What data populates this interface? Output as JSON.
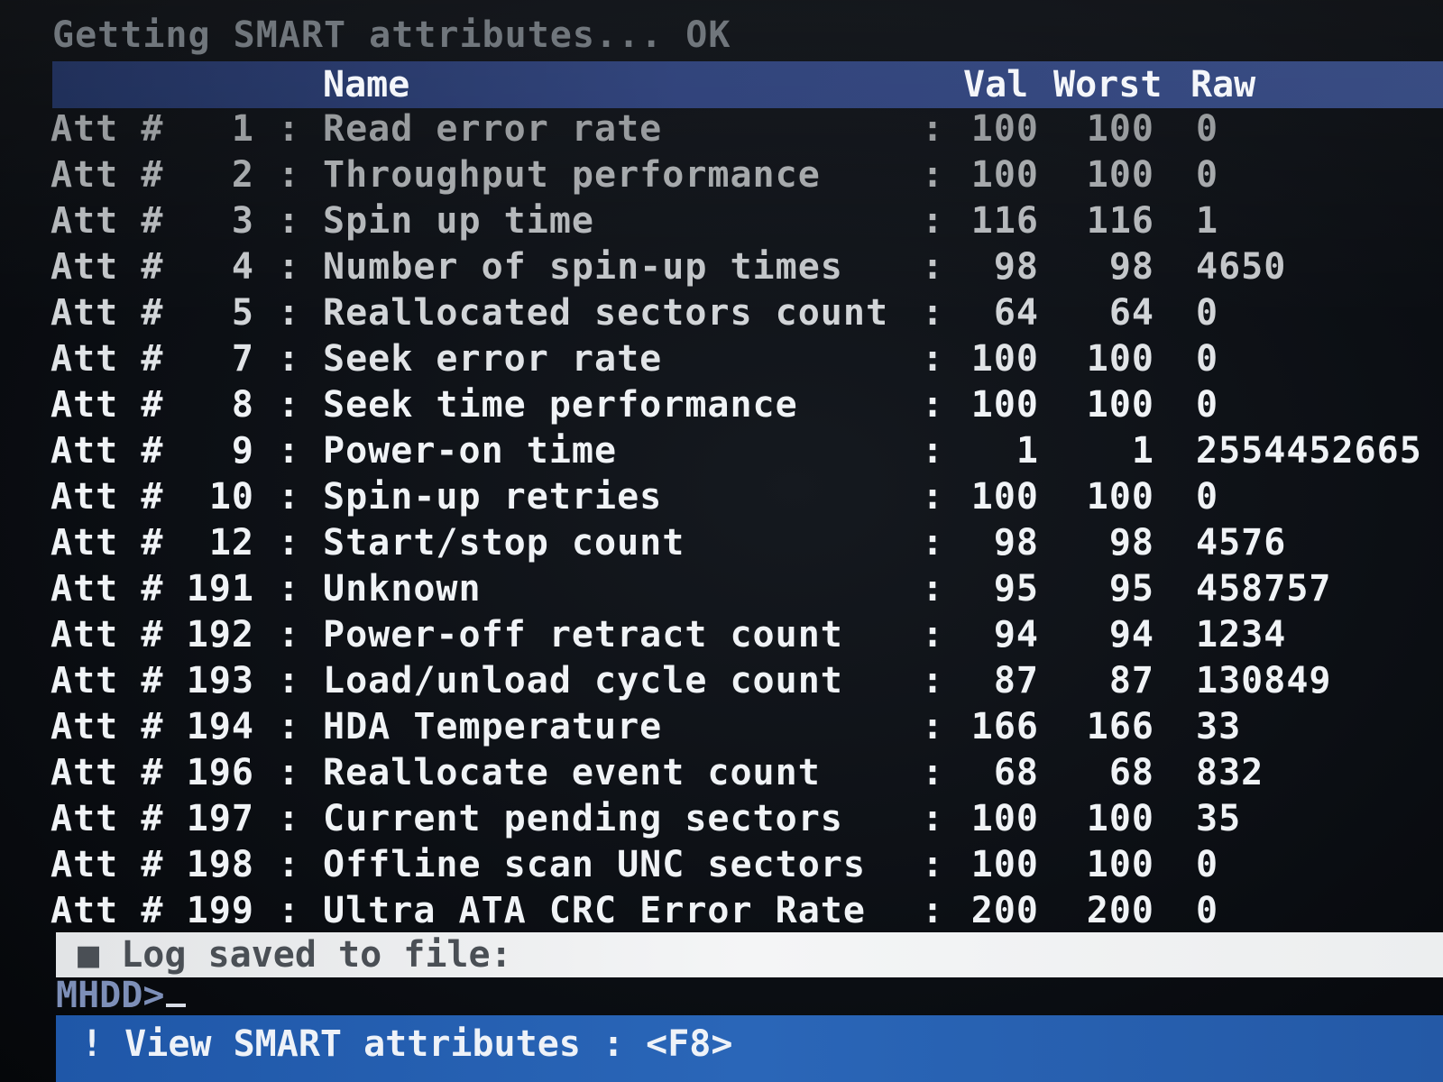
{
  "status": {
    "text": "Getting SMART attributes... OK"
  },
  "header": {
    "name": "Name",
    "val": "Val",
    "worst": "Worst",
    "raw": "Raw"
  },
  "rows": [
    {
      "prefix": "Att #",
      "num": "1",
      "name": "Read error rate",
      "val": "100",
      "worst": "100",
      "raw": "0"
    },
    {
      "prefix": "Att #",
      "num": "2",
      "name": "Throughput performance",
      "val": "100",
      "worst": "100",
      "raw": "0"
    },
    {
      "prefix": "Att #",
      "num": "3",
      "name": "Spin up time",
      "val": "116",
      "worst": "116",
      "raw": "1"
    },
    {
      "prefix": "Att #",
      "num": "4",
      "name": "Number of spin-up times",
      "val": "98",
      "worst": "98",
      "raw": "4650"
    },
    {
      "prefix": "Att #",
      "num": "5",
      "name": "Reallocated sectors count",
      "val": "64",
      "worst": "64",
      "raw": "0"
    },
    {
      "prefix": "Att #",
      "num": "7",
      "name": "Seek error rate",
      "val": "100",
      "worst": "100",
      "raw": "0"
    },
    {
      "prefix": "Att #",
      "num": "8",
      "name": "Seek time performance",
      "val": "100",
      "worst": "100",
      "raw": "0"
    },
    {
      "prefix": "Att #",
      "num": "9",
      "name": "Power-on time",
      "val": "1",
      "worst": "1",
      "raw": "2554452665"
    },
    {
      "prefix": "Att #",
      "num": "10",
      "name": "Spin-up retries",
      "val": "100",
      "worst": "100",
      "raw": "0"
    },
    {
      "prefix": "Att #",
      "num": "12",
      "name": "Start/stop count",
      "val": "98",
      "worst": "98",
      "raw": "4576"
    },
    {
      "prefix": "Att #",
      "num": "191",
      "name": "Unknown",
      "val": "95",
      "worst": "95",
      "raw": "458757"
    },
    {
      "prefix": "Att #",
      "num": "192",
      "name": "Power-off retract count",
      "val": "94",
      "worst": "94",
      "raw": "1234"
    },
    {
      "prefix": "Att #",
      "num": "193",
      "name": "Load/unload cycle count",
      "val": "87",
      "worst": "87",
      "raw": "130849"
    },
    {
      "prefix": "Att #",
      "num": "194",
      "name": "HDA Temperature",
      "val": "166",
      "worst": "166",
      "raw": "33"
    },
    {
      "prefix": "Att #",
      "num": "196",
      "name": "Reallocate event count",
      "val": "68",
      "worst": "68",
      "raw": "832"
    },
    {
      "prefix": "Att #",
      "num": "197",
      "name": "Current pending sectors",
      "val": "100",
      "worst": "100",
      "raw": "35"
    },
    {
      "prefix": "Att #",
      "num": "198",
      "name": "Offline scan UNC sectors",
      "val": "100",
      "worst": "100",
      "raw": "0"
    },
    {
      "prefix": "Att #",
      "num": "199",
      "name": "Ultra ATA CRC Error Rate",
      "val": "200",
      "worst": "200",
      "raw": "0"
    }
  ],
  "row_separator": ":",
  "log": {
    "text": "Log saved to file:",
    "bullet": "■"
  },
  "prompt": {
    "text": "MHDD>"
  },
  "footer": {
    "text": "! View SMART attributes : <F8>"
  },
  "colors": {
    "text_dim": "#6b7177",
    "text_bright": "#eef1f4",
    "header_bar": "#2c3f78",
    "log_bar": "#f0f1f2",
    "footer_bar": "#2a66b8",
    "prompt": "#7d8fb8"
  }
}
